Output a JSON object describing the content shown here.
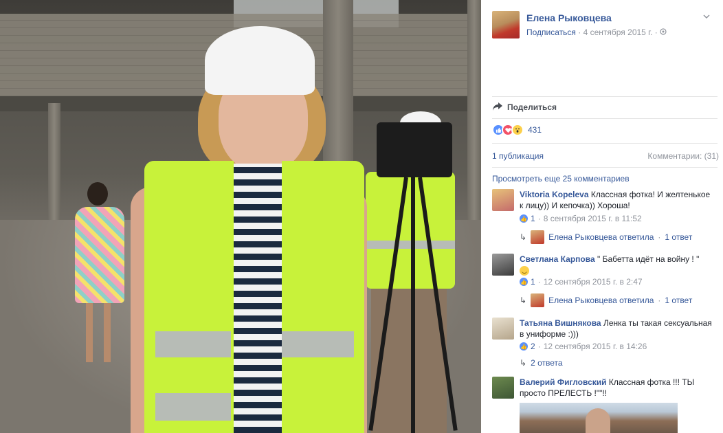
{
  "post": {
    "author": "Елена Рыковцева",
    "subscribe": "Подписаться",
    "date": "4 сентября 2015 г.",
    "separator": "·",
    "chevron_icon": "chevron-down-icon",
    "globe_icon": "globe-icon"
  },
  "actions": {
    "share_label": "Поделиться",
    "share_icon": "share-arrow-icon"
  },
  "reactions": {
    "icons": [
      "like-icon",
      "love-icon",
      "wow-icon"
    ],
    "count": "431"
  },
  "stats": {
    "publications": "1 публикация",
    "comments": "Комментарии: (31)"
  },
  "more_comments": "Просмотреть еще 25 комментариев",
  "comments": [
    {
      "author": "Viktoria Kopeleva",
      "text": "Классная фотка! И желтенькое к лицу)) И кепочка)) Хороша!",
      "likes": "1",
      "time": "8 сентября 2015 г. в 11:52",
      "reply_author": "Елена Рыковцева ответила",
      "reply_count": "1 ответ"
    },
    {
      "author": "Светлана Карпова",
      "text": "\" Бабетта идёт на войну ! \"",
      "likes": "1",
      "time": "12 сентября 2015 г. в 2:47",
      "reply_author": "Елена Рыковцева ответила",
      "reply_count": "1 ответ"
    },
    {
      "author": "Татьяна Вишнякова",
      "text": "Ленка ты такая сексуальная в униформе :)))",
      "likes": "2",
      "time": "12 сентября 2015 г. в 14:26",
      "reply_count": "2 ответа"
    },
    {
      "author": "Валерий Фигловский",
      "text": "Классная фотка !!! ТЫ просто ПРЕЛЕСТЬ !\"\"!!"
    }
  ],
  "colors": {
    "link": "#365899",
    "muted": "#90949c",
    "vest": "#c8f23a",
    "like": "#5890ff",
    "love": "#f25268",
    "wow": "#fcd04a"
  }
}
